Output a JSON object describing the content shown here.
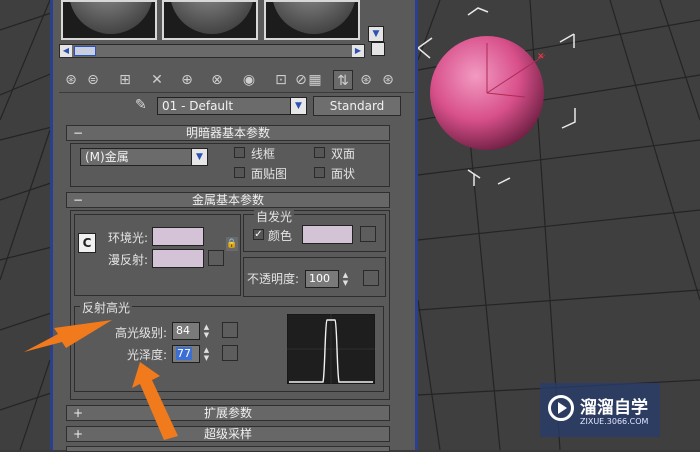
{
  "material": {
    "name": "01 - Default",
    "type_button": "Standard"
  },
  "shader_basic": {
    "title": "明暗器基本参数",
    "shader": "(M)金属",
    "options": [
      "线框",
      "双面",
      "面贴图",
      "面状"
    ]
  },
  "metal_basic": {
    "title": "金属基本参数",
    "lock_label": "C",
    "ambient_label": "环境光:",
    "diffuse_label": "漫反射:",
    "self_illum": {
      "title": "自发光",
      "color_label": "颜色",
      "color_checked": true
    },
    "opacity_label": "不透明度:",
    "opacity_value": "100",
    "colors": {
      "ambient": "#d4c3d6",
      "diffuse": "#d4c3d6",
      "self_illum": "#d4c3d6"
    }
  },
  "specular": {
    "title": "反射高光",
    "level_label": "高光级别:",
    "level_value": "84",
    "gloss_label": "光泽度:",
    "gloss_value": "77"
  },
  "rollouts": {
    "extended": "扩展参数",
    "supersampling": "超级采样"
  },
  "viewport": {
    "sphere_color": "#d8508a"
  },
  "watermark": {
    "text": "溜溜自学",
    "url": "ZIXUE.3066.COM"
  }
}
